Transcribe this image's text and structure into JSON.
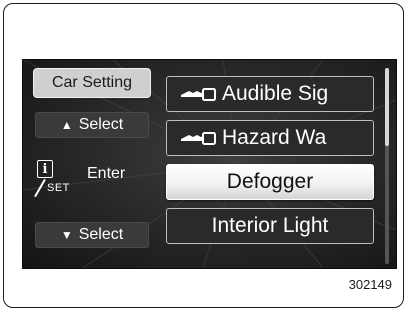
{
  "left_panel": {
    "car_setting": "Car Setting",
    "up_select": "Select",
    "enter": "Enter",
    "info_set_label": "SET",
    "info_letter": "i",
    "down_select": "Select"
  },
  "menu": {
    "items": [
      {
        "label": "Audible Sig",
        "icon": "key-icon"
      },
      {
        "label": "Hazard Wa",
        "icon": "key-icon"
      },
      {
        "label": "Defogger",
        "selected": true
      },
      {
        "label": "Interior Light"
      }
    ]
  },
  "scrollbar": {
    "position_fraction": 0.0,
    "visible_fraction": 0.4
  },
  "figure_number": "302149"
}
